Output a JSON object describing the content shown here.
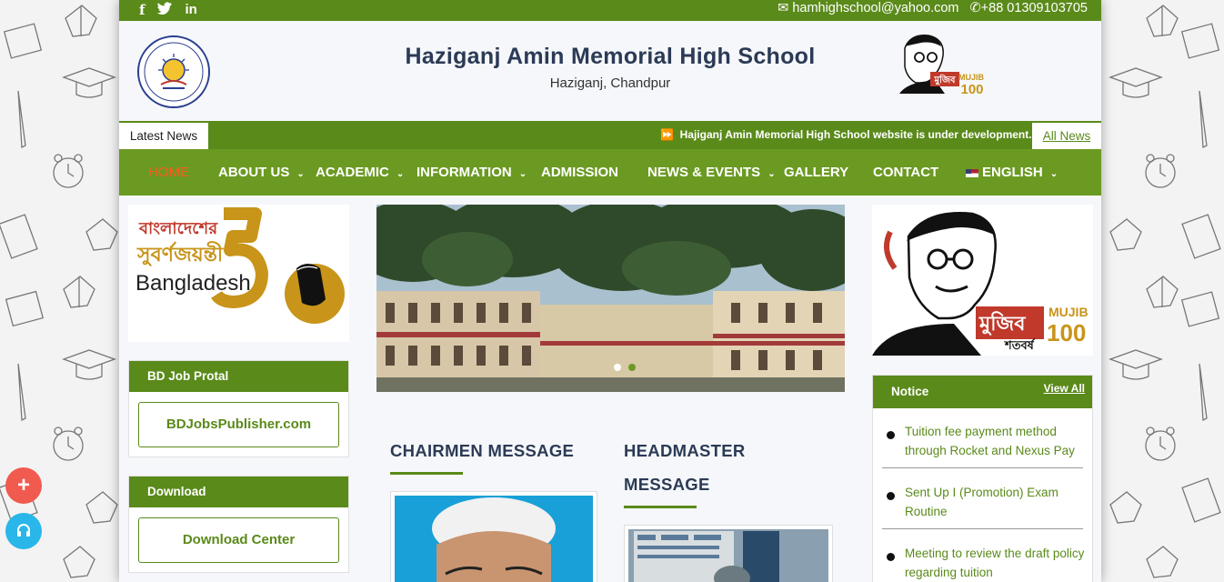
{
  "topbar": {
    "social": [
      {
        "icon": "facebook-icon",
        "glyph": "f"
      },
      {
        "icon": "twitter-icon",
        "glyph": "🐦"
      },
      {
        "icon": "linkedin-icon",
        "glyph": "in"
      }
    ],
    "email": "hamhighschool@yahoo.com",
    "phone": "+88 01309103705"
  },
  "header": {
    "school_name": "Haziganj Amin Memorial High School",
    "location": "Haziganj, Chandpur"
  },
  "ticker": {
    "label": "Latest News",
    "text": "Hajiganj Amin Memorial High School website is under development.",
    "all_news": "All News"
  },
  "nav": {
    "items": [
      {
        "label": "HOME",
        "dropdown": false
      },
      {
        "label": "ABOUT US",
        "dropdown": true
      },
      {
        "label": "ACADEMIC",
        "dropdown": true
      },
      {
        "label": "INFORMATION",
        "dropdown": true
      },
      {
        "label": "ADMISSION",
        "dropdown": false
      },
      {
        "label": "NEWS & EVENTS",
        "dropdown": true
      },
      {
        "label": "GALLERY",
        "dropdown": false
      },
      {
        "label": "CONTACT",
        "dropdown": false
      },
      {
        "label": "ENGLISH",
        "dropdown": true
      }
    ]
  },
  "left": {
    "banner": {
      "line1": "বাংলাদেশের",
      "line2": "সুবর্ণজয়ন্তী",
      "line3": "Bangladesh",
      "number": "50"
    },
    "job_box": {
      "title": "BD Job Protal",
      "button": "BDJobsPublisher.com"
    },
    "download_box": {
      "title": "Download",
      "button": "Download Center"
    }
  },
  "main": {
    "chairman_title": "CHAIRMEN MESSAGE",
    "headmaster_title_line1": "HEADMASTER",
    "headmaster_title_line2": "MESSAGE"
  },
  "right": {
    "mujib_banner": {
      "bangla": "মুজিব",
      "sub": "শতবর্ষ",
      "en": "MUJIB",
      "num": "100"
    },
    "notice": {
      "title": "Notice",
      "view_all": "View All",
      "items": [
        "Tuition fee payment method through Rocket and Nexus Pay",
        "Sent Up I (Promotion) Exam Routine",
        "Meeting to review the draft policy regarding tuition"
      ]
    }
  },
  "floating": {
    "plus": "+",
    "headset_icon": "headset-icon"
  },
  "colors": {
    "green": "#5a8a1a",
    "nav_green": "#6b9a22",
    "active": "#ff5a1f",
    "title": "#2b3a55"
  }
}
